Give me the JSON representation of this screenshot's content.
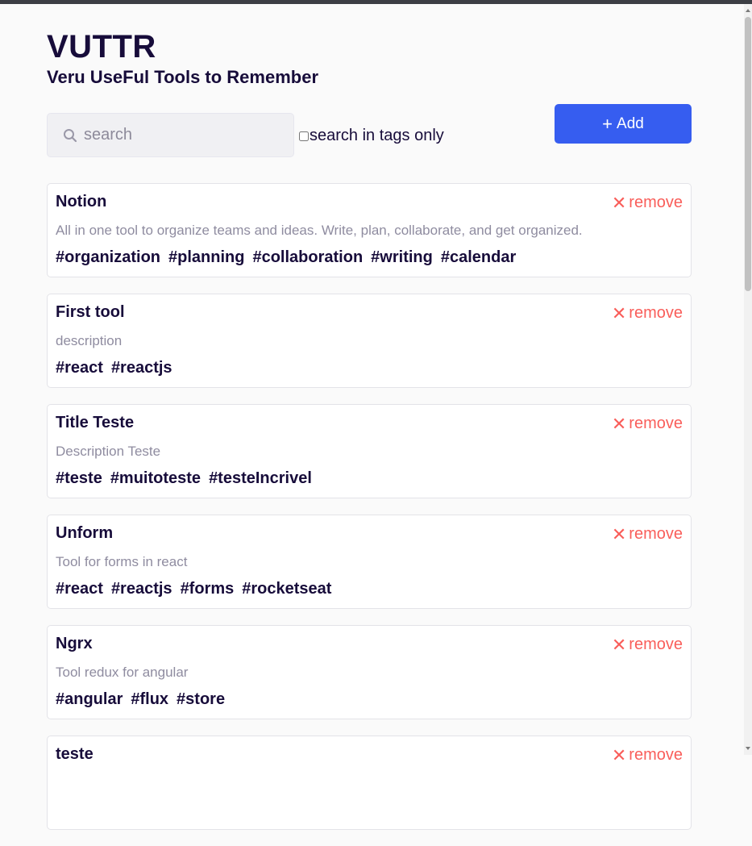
{
  "header": {
    "title": "VUTTR",
    "subtitle": "Veru UseFul Tools to Remember"
  },
  "search": {
    "placeholder": "search",
    "value": "",
    "icon": "search-icon",
    "tags_only_label": "search in tags only",
    "tags_only_checked": false
  },
  "toolbar": {
    "add_icon": "+",
    "add_label": "Add"
  },
  "colors": {
    "accent": "#365df0",
    "danger": "#f95e5a",
    "text": "#170c3a",
    "muted": "#8f8ca0"
  },
  "remove": {
    "icon": "✕",
    "label": "remove"
  },
  "tools": [
    {
      "title": "Notion",
      "description": "All in one tool to organize teams and ideas. Write, plan, collaborate, and get organized.",
      "tags": [
        "#organization",
        "#planning",
        "#collaboration",
        "#writing",
        "#calendar"
      ]
    },
    {
      "title": "First tool",
      "description": "description",
      "tags": [
        "#react",
        "#reactjs"
      ]
    },
    {
      "title": "Title Teste",
      "description": "Description Teste",
      "tags": [
        "#teste",
        "#muitoteste",
        "#testeIncrivel"
      ]
    },
    {
      "title": "Unform",
      "description": "Tool for forms in react",
      "tags": [
        "#react",
        "#reactjs",
        "#forms",
        "#rocketseat"
      ]
    },
    {
      "title": "Ngrx",
      "description": "Tool redux for angular",
      "tags": [
        "#angular",
        "#flux",
        "#store"
      ]
    },
    {
      "title": "teste",
      "description": "",
      "tags": []
    }
  ]
}
